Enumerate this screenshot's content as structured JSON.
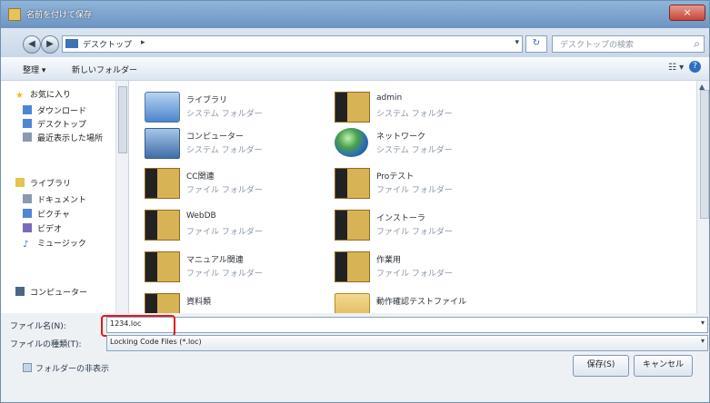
{
  "window": {
    "title": "名前を付けて保存",
    "close_icon": "×"
  },
  "address": {
    "path": "デスクトップ",
    "path_arrow": "▸",
    "dropdown_arrow": "▾",
    "refresh_icon": "↻",
    "search_placeholder": "デスクトップの検索",
    "search_icon": "⌕"
  },
  "toolbar": {
    "organize": "整理 ▾",
    "new_folder": "新しいフォルダー",
    "view_icon": "☷ ▾",
    "help_icon": "?"
  },
  "nav": {
    "back_icon": "◀",
    "forward_icon": "▶",
    "items": [
      "お気に入り",
      "ダウンロード",
      "デスクトップ",
      "最近表示した場所",
      "ライブラリ",
      "ドキュメント",
      "ピクチャ",
      "ビデオ",
      "ミュージック",
      "コンピューター"
    ]
  },
  "files": [
    {
      "name": "ライブラリ",
      "type": "システム フォルダー"
    },
    {
      "name": "admin",
      "type": "システム フォルダー"
    },
    {
      "name": "コンピューター",
      "type": "システム フォルダー"
    },
    {
      "name": "ネットワーク",
      "type": "システム フォルダー"
    },
    {
      "name": "CC関連",
      "type": "ファイル フォルダー"
    },
    {
      "name": "Proテスト",
      "type": "ファイル フォルダー"
    },
    {
      "name": "WebDB",
      "type": "ファイル フォルダー"
    },
    {
      "name": "インストーラ",
      "type": "ファイル フォルダー"
    },
    {
      "name": "マニュアル関連",
      "type": "ファイル フォルダー"
    },
    {
      "name": "作業用",
      "type": "ファイル フォルダー"
    },
    {
      "name": "資料類",
      "type": ""
    },
    {
      "name": "動作確認テストファイル",
      "type": ""
    }
  ],
  "form": {
    "filename_label": "ファイル名(N):",
    "filename_value": "1234.loc",
    "filetype_label": "ファイルの種類(T):",
    "filetype_value": "Locking Code Files (*.loc)",
    "dropdown_arrow": "▾"
  },
  "footer": {
    "hide_folders": "フォルダーの非表示",
    "save_button": "保存(S)",
    "cancel_button": "キャンセル"
  },
  "colors": {
    "highlight": "#e11a1a",
    "window_frame": "#6f8fae"
  }
}
